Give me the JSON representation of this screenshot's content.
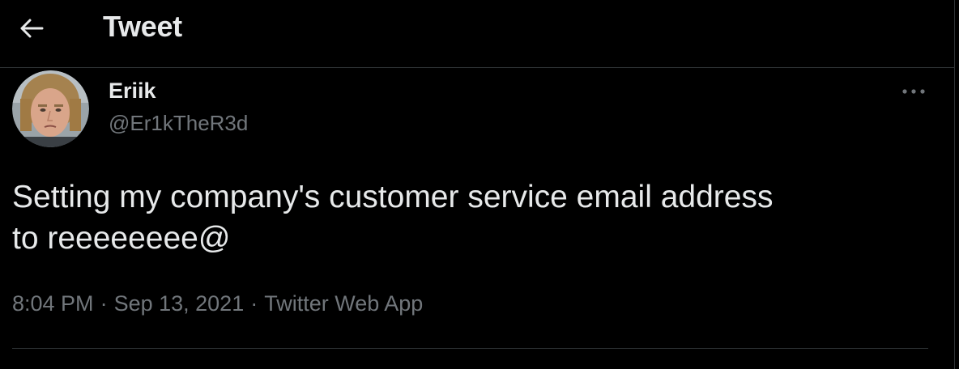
{
  "header": {
    "title": "Tweet",
    "back_icon": "arrow-left-icon"
  },
  "tweet": {
    "author": {
      "display_name": "Eriik",
      "handle": "@Er1kTheR3d",
      "avatar_icon": "user-avatar-photo"
    },
    "more_icon": "more-horizontal-icon",
    "text": "Setting my company's customer service email address\nto reeeeeeee@",
    "time": "8:04 PM",
    "separator_1": "·",
    "date": "Sep 13, 2021",
    "separator_2": "·",
    "source": "Twitter Web App"
  },
  "colors": {
    "background": "#000000",
    "primary_text": "#e7e9ea",
    "secondary_text": "#71767b",
    "divider": "#2f3336"
  }
}
